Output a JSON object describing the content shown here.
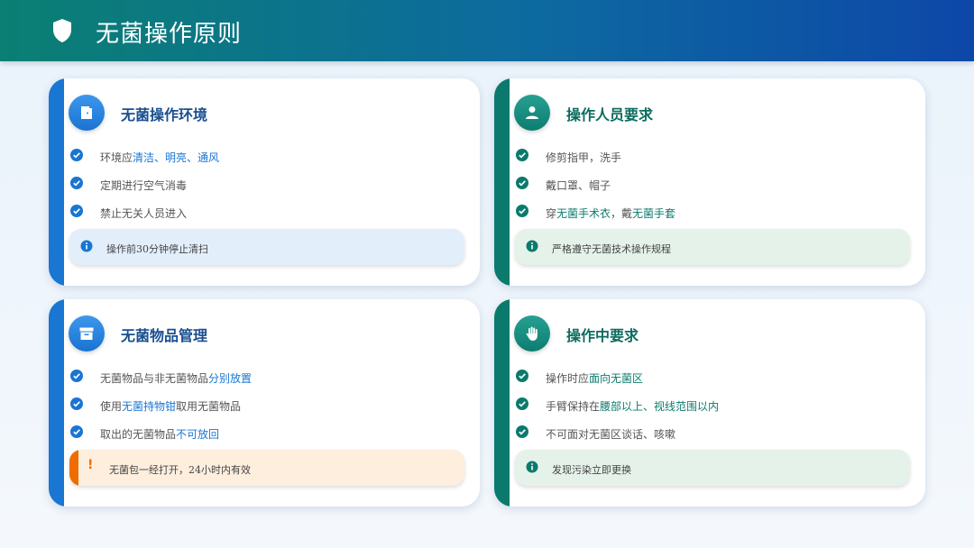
{
  "header": {
    "title": "无菌操作原则"
  },
  "cards": [
    {
      "title": "无菌操作环境",
      "icon": "door-icon",
      "items": [
        {
          "text": "环境应",
          "highlight": "清洁、明亮、通风",
          "after": ""
        },
        {
          "text": "定期进行空气消毒",
          "highlight": "",
          "after": ""
        },
        {
          "text": "禁止无关人员进入",
          "highlight": "",
          "after": ""
        }
      ],
      "note": {
        "type": "info",
        "text": "操作前30分钟停止清扫"
      }
    },
    {
      "title": "操作人员要求",
      "icon": "person-icon",
      "items": [
        {
          "text": "修剪指甲，洗手",
          "highlight": "",
          "after": ""
        },
        {
          "text": "戴口罩、帽子",
          "highlight": "",
          "after": ""
        },
        {
          "text": "穿",
          "highlight": "无菌手术衣",
          "mid": "，戴",
          "highlight2": "无菌手套"
        }
      ],
      "note": {
        "type": "info",
        "text": "严格遵守无菌技术操作规程"
      }
    },
    {
      "title": "无菌物品管理",
      "icon": "archive-box-icon",
      "items": [
        {
          "text": "无菌物品与非无菌物品",
          "highlight": "分别放置",
          "after": ""
        },
        {
          "text": "使用",
          "highlight": "无菌持物钳",
          "after": "取用无菌物品"
        },
        {
          "text": "取出的无菌物品",
          "highlight": "不可放回",
          "after": ""
        }
      ],
      "note": {
        "type": "warning",
        "text": "无菌包一经打开，24小时内有效"
      }
    },
    {
      "title": "操作中要求",
      "icon": "hand-icon",
      "items": [
        {
          "text": "操作时应",
          "highlight": "面向无菌区",
          "after": ""
        },
        {
          "text": "手臂保持在",
          "highlight": "腰部以上、视线范围以内",
          "after": ""
        },
        {
          "text": "不可面对无菌区谈话、咳嗽",
          "highlight": "",
          "after": ""
        }
      ],
      "note": {
        "type": "info",
        "text": "发现污染立即更换"
      }
    }
  ],
  "colors": {
    "blue_accent": "#1976d2",
    "green_accent": "#0b7a6c",
    "warning": "#ef6c00"
  }
}
